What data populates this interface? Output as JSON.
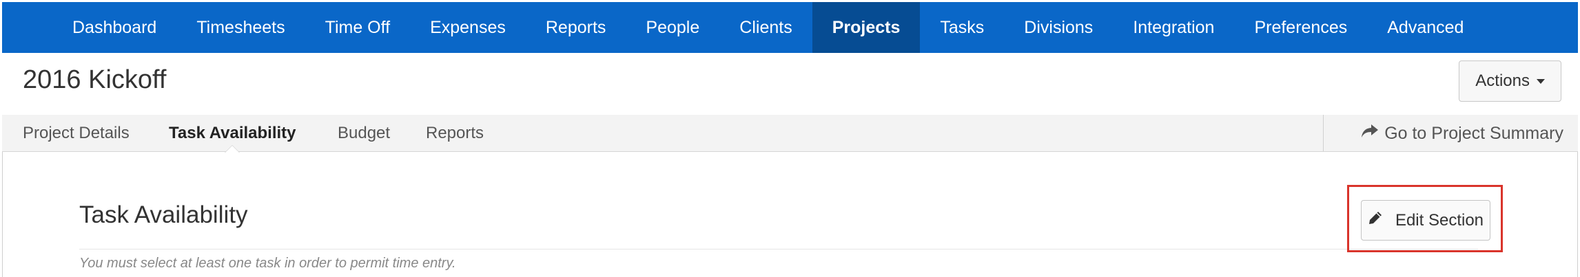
{
  "nav": {
    "items": [
      {
        "label": "Dashboard",
        "active": false
      },
      {
        "label": "Timesheets",
        "active": false
      },
      {
        "label": "Time Off",
        "active": false
      },
      {
        "label": "Expenses",
        "active": false
      },
      {
        "label": "Reports",
        "active": false
      },
      {
        "label": "People",
        "active": false
      },
      {
        "label": "Clients",
        "active": false
      },
      {
        "label": "Projects",
        "active": true
      },
      {
        "label": "Tasks",
        "active": false
      },
      {
        "label": "Divisions",
        "active": false
      },
      {
        "label": "Integration",
        "active": false
      },
      {
        "label": "Preferences",
        "active": false
      },
      {
        "label": "Advanced",
        "active": false
      }
    ]
  },
  "header": {
    "title": "2016 Kickoff",
    "actions_label": "Actions"
  },
  "subnav": {
    "tabs": [
      {
        "label": "Project Details"
      },
      {
        "label": "Task Availability"
      },
      {
        "label": "Budget"
      },
      {
        "label": "Reports"
      }
    ],
    "active_tab": "Task Availability",
    "goto_label": "Go to Project Summary"
  },
  "section": {
    "title": "Task Availability",
    "hint": "You must select at least one task in order to permit time entry.",
    "edit_label": "Edit Section"
  },
  "colors": {
    "nav_bg": "#0a67c8",
    "nav_active_bg": "#064c93",
    "highlight": "#d9342b"
  },
  "icons": {
    "goto": "share-arrow-icon",
    "edit": "pencil-icon",
    "actions": "caret-down-icon"
  }
}
